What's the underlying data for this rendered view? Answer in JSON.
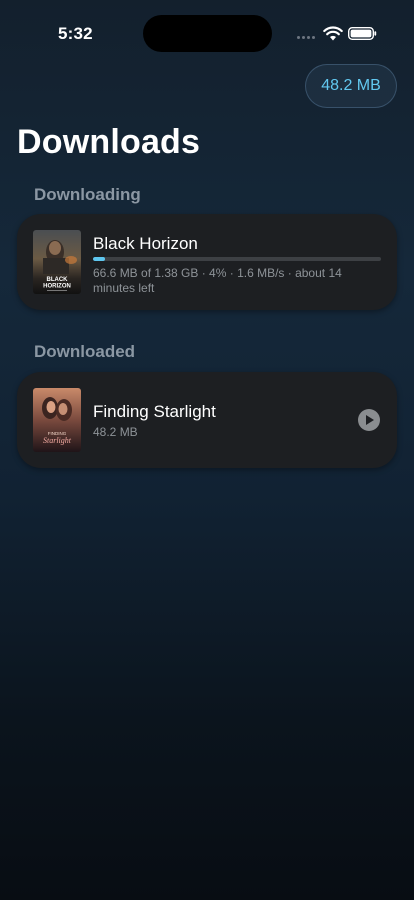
{
  "status_bar": {
    "time": "5:32"
  },
  "header": {
    "storage_used": "48.2 MB",
    "title": "Downloads"
  },
  "sections": {
    "downloading": {
      "title": "Downloading",
      "items": [
        {
          "title": "Black Horizon",
          "poster_text": "BLACK HORIZON",
          "progress_percent": 4,
          "details": "66.6 MB of 1.38 GB · 4% · 1.6 MB/s · about 14 minutes left"
        }
      ]
    },
    "downloaded": {
      "title": "Downloaded",
      "items": [
        {
          "title": "Finding Starlight",
          "poster_text_top": "FINDING",
          "poster_text_bottom": "Starlight",
          "size": "48.2 MB"
        }
      ]
    }
  },
  "colors": {
    "accent": "#5ec6ef",
    "card_background": "#1d1f22",
    "section_title": "#8b97a3"
  }
}
